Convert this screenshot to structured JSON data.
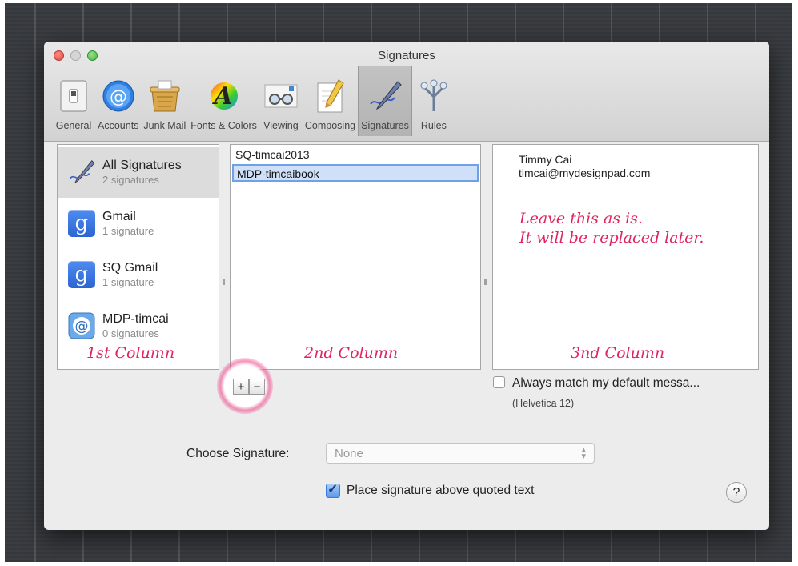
{
  "window": {
    "title": "Signatures"
  },
  "toolbar": {
    "items": [
      {
        "label": "General",
        "icon": "switch-icon"
      },
      {
        "label": "Accounts",
        "icon": "at-sign-icon"
      },
      {
        "label": "Junk Mail",
        "icon": "trash-bin-icon"
      },
      {
        "label": "Fonts & Colors",
        "icon": "font-color-icon"
      },
      {
        "label": "Viewing",
        "icon": "glasses-icon"
      },
      {
        "label": "Composing",
        "icon": "pencil-paper-icon"
      },
      {
        "label": "Signatures",
        "icon": "signature-pen-icon"
      },
      {
        "label": "Rules",
        "icon": "rules-icon"
      }
    ],
    "selected": "Signatures"
  },
  "accounts": [
    {
      "name": "All Signatures",
      "count": "2 signatures",
      "icon": "signature-pen-icon"
    },
    {
      "name": "Gmail",
      "count": "1 signature",
      "icon": "google-icon"
    },
    {
      "name": "SQ Gmail",
      "count": "1 signature",
      "icon": "google-icon"
    },
    {
      "name": "MDP-timcai",
      "count": "0 signatures",
      "icon": "mail-at-icon"
    }
  ],
  "signatures": [
    "SQ-timcai2013",
    "MDP-timcaibook"
  ],
  "preview": {
    "name": "Timmy Cai",
    "email": "timcai@mydesignpad.com"
  },
  "annotations": {
    "col1": "1st Column",
    "col2": "2nd Column",
    "col3": "3nd Column",
    "note_line1": "Leave this as is.",
    "note_line2": "It will be replaced later."
  },
  "buttons": {
    "add": "+",
    "remove": "−",
    "help": "?"
  },
  "always_match": {
    "label": "Always match my default messa...",
    "font_note": "(Helvetica 12)",
    "checked": false
  },
  "choose_signature": {
    "label": "Choose Signature:",
    "value": "None"
  },
  "place_above": {
    "label": "Place signature above quoted text",
    "checked": true
  },
  "colors": {
    "annotation": "#e0245e",
    "highlight": "#cfe0f8"
  }
}
